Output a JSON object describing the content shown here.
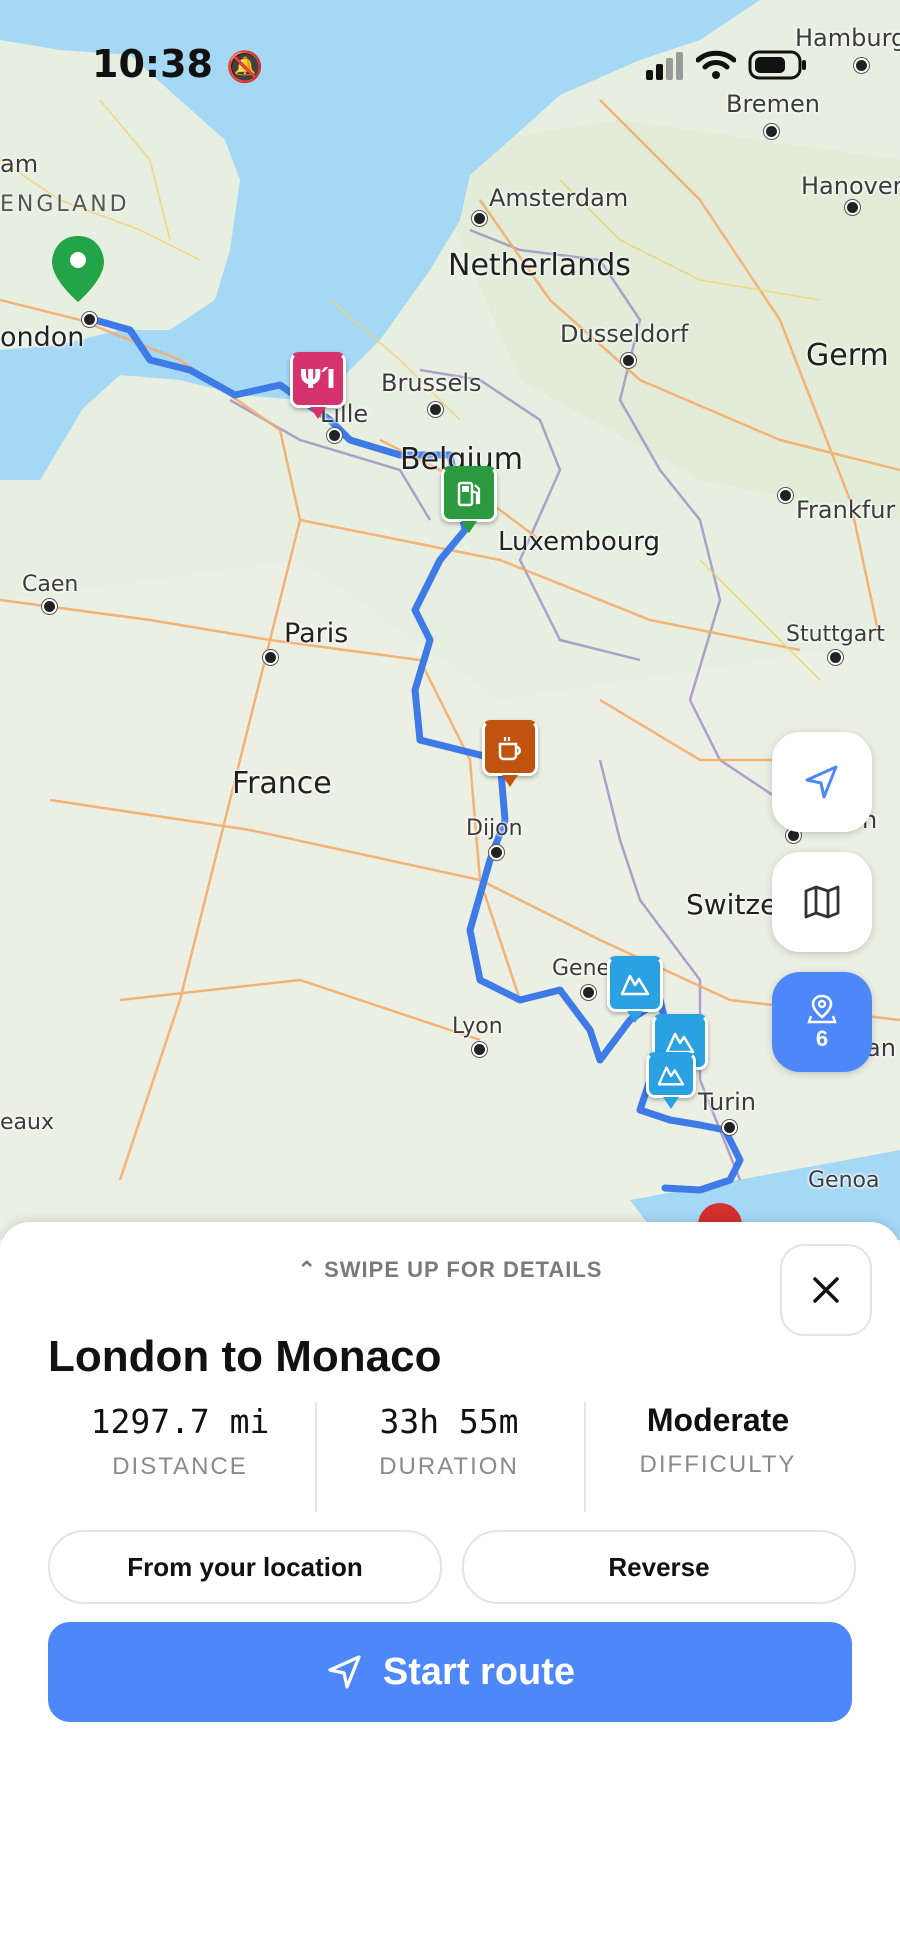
{
  "status_bar": {
    "time": "10:38"
  },
  "map": {
    "cities": {
      "amsterdam": "Amsterdam",
      "hamburg": "Hamburg",
      "bremen": "Bremen",
      "hanover": "Hanover",
      "dusseldorf": "Dusseldorf",
      "brussels": "Brussels",
      "lille": "Lille",
      "london": "ondon",
      "am": "am",
      "caen": "Caen",
      "paris": "Paris",
      "luxembourg": "Luxembourg",
      "frankfurt": "Frankfur",
      "stuttgart": "Stuttgart",
      "dijon": "Dijon",
      "geneva": "Gene",
      "lyon": "Lyon",
      "turin": "Turin",
      "genoa": "Genoa",
      "bordeaux": "eaux",
      "milan": "an",
      "zurich": "n"
    },
    "countries": {
      "netherlands": "Netherlands",
      "germany": "Germ",
      "belgium": "Belgium",
      "france": "France",
      "switzerland": "Switze"
    },
    "regions": {
      "england": "ENGLAND"
    },
    "poi_count": "6"
  },
  "sheet": {
    "swipe_hint": "SWIPE UP FOR DETAILS",
    "title": "London to Monaco",
    "stats": [
      {
        "value": "1297.7 mi",
        "label": "DISTANCE"
      },
      {
        "value": "33h 55m",
        "label": "DURATION"
      },
      {
        "value": "Moderate",
        "label": "DIFFICULTY"
      }
    ],
    "from_location_label": "From your location",
    "reverse_label": "Reverse",
    "start_label": "Start route"
  },
  "colors": {
    "route": "#3f7be6",
    "accent": "#4e87f7",
    "poi_restaurant": "#d6336c",
    "poi_fuel": "#2b9a3e",
    "poi_cafe": "#c0540f",
    "poi_mountain": "#2aa1e0",
    "start_pin": "#22a447",
    "end_pin": "#d32f2f"
  }
}
